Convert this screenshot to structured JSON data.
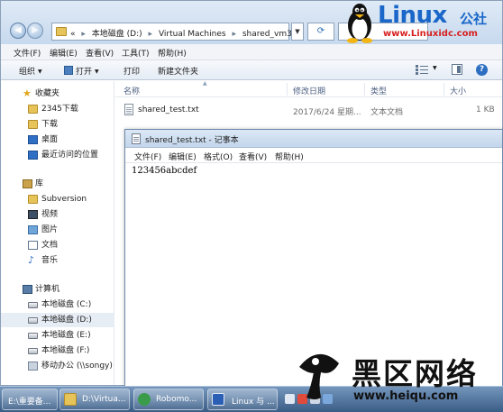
{
  "explorer": {
    "address": {
      "prefix": "«",
      "crumbs": [
        "本地磁盘 (D:)",
        "Virtual Machines",
        "shared_vm3"
      ],
      "separator": "▸"
    },
    "menu": [
      "文件(F)",
      "编辑(E)",
      "查看(V)",
      "工具(T)",
      "帮助(H)"
    ],
    "toolbar": {
      "organize": "组织",
      "open": "打开",
      "print": "打印",
      "new_folder": "新建文件夹"
    },
    "sidebar": {
      "favorites_header": "收藏夹",
      "favorites": [
        "2345下载",
        "下载",
        "桌面",
        "最近访问的位置"
      ],
      "libraries_header": "库",
      "libraries": [
        "Subversion",
        "视频",
        "图片",
        "文档",
        "音乐"
      ],
      "computer_header": "计算机",
      "drives": [
        "本地磁盘 (C:)",
        "本地磁盘 (D:)",
        "本地磁盘 (E:)",
        "本地磁盘 (F:)",
        "移动办公 (\\\\songy)"
      ]
    },
    "columns": [
      "名称",
      "修改日期",
      "类型",
      "大小"
    ],
    "files": [
      {
        "name": "shared_test.txt",
        "modified": "2017/6/24 星期...",
        "type": "文本文档",
        "size": "1 KB"
      }
    ]
  },
  "notepad": {
    "title": "shared_test.txt - 记事本",
    "menu": [
      "文件(F)",
      "编辑(E)",
      "格式(O)",
      "查看(V)",
      "帮助(H)"
    ],
    "content": "123456abcdef"
  },
  "taskbar": {
    "buttons": [
      "E:\\重要备...",
      "D:\\Virtua...",
      "Robomo...",
      "Linux 与 ..."
    ]
  },
  "watermarks": {
    "top": {
      "word": "Linux",
      "cn": "公社",
      "url": "www.Linuxidc.com"
    },
    "bottom": {
      "big": "黑区网络",
      "small": "www.heiqu.com"
    }
  },
  "colors": {
    "accent_blue": "#1a67c9",
    "url_red": "#d6201f",
    "taskbar": "#3a5d86"
  }
}
